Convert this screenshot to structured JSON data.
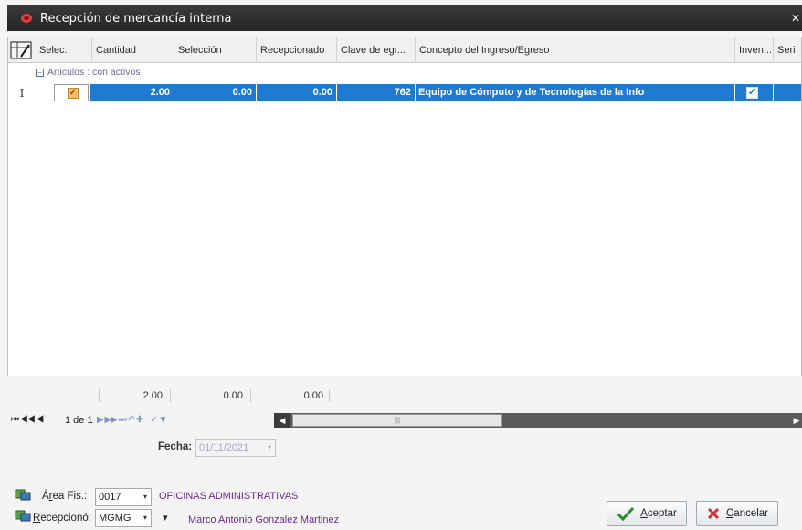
{
  "window": {
    "title": "Recepción de mercancía interna"
  },
  "grid": {
    "columns": [
      "Selec.",
      "Cantidad",
      "Selección",
      "Recepcionado",
      "Clave de egr...",
      "Concepto del Ingreso/Egreso",
      "Inven...",
      "Seri"
    ],
    "group": {
      "label": "Articulos : con activos"
    },
    "row": {
      "indicator": "I",
      "selected": true,
      "cantidad": "2.00",
      "seleccion": "0.00",
      "recepcionado": "0.00",
      "clave": "762",
      "concepto": "Equipo de Cómputo y de Tecnologías de la Info",
      "inventario": true
    },
    "totals": {
      "cantidad": "2.00",
      "seleccion": "0.00",
      "recepcionado": "0.00"
    }
  },
  "navigator": {
    "page": "1 de 1"
  },
  "form": {
    "fecha_label_u": "F",
    "fecha_label_rest": "echa:",
    "fecha_value": "01/11/2021",
    "area_label_a": "Á",
    "area_label_u": "r",
    "area_label_rest": "ea Fis.:",
    "area_code": "0017",
    "area_name": "OFICINAS ADMINISTRATIVAS",
    "recepciono_label_u": "R",
    "recepciono_label_rest": "ecepcionó:",
    "recepciono_code": "MGMG",
    "recepciono_name": "Marco Antonio Gonzalez Martinez"
  },
  "buttons": {
    "aceptar_u": "A",
    "aceptar_rest": "ceptar",
    "cancelar_u": "C",
    "cancelar_rest": "ancelar"
  },
  "colors": {
    "selection": "#1f7ad0",
    "titlebar": "#2f2f2f",
    "accent_red": "#e04040",
    "link_purple": "#6a2a8c"
  }
}
